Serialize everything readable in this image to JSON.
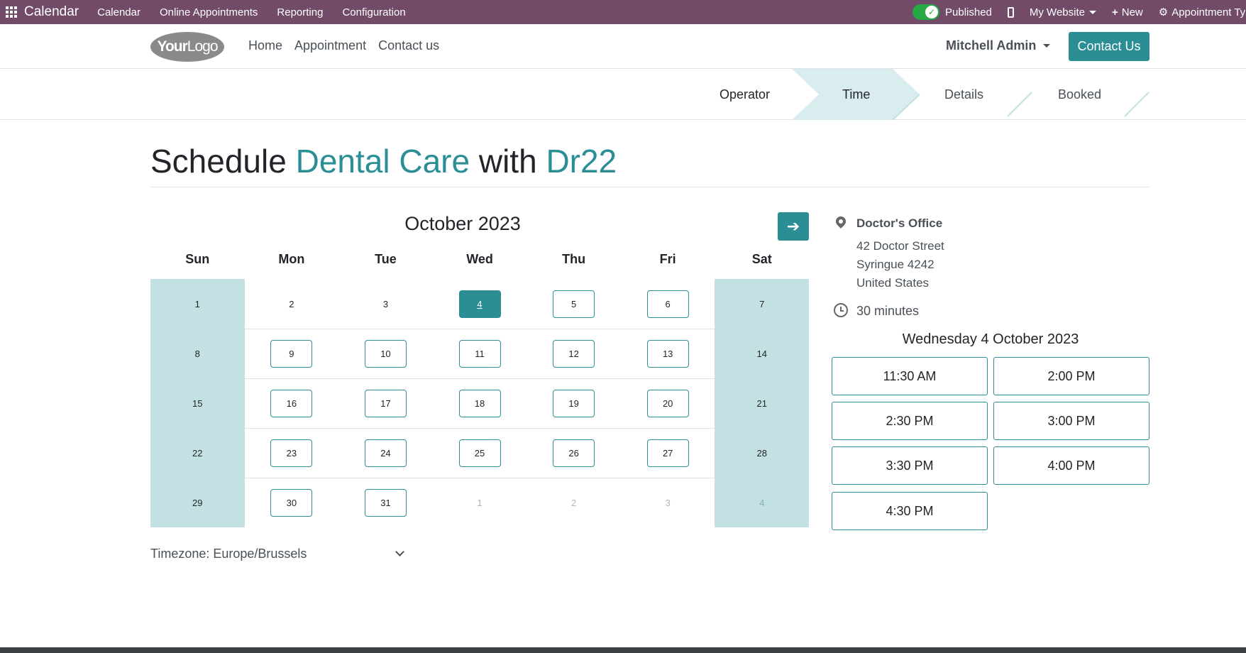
{
  "topbar": {
    "app_name": "Calendar",
    "menus": [
      "Calendar",
      "Online Appointments",
      "Reporting",
      "Configuration"
    ],
    "published": "Published",
    "my_website": "My Website",
    "new": "New",
    "appointment_type": "Appointment Typ",
    "bar_color": "#714b67"
  },
  "header": {
    "logo_text_bold": "Your",
    "logo_text_thin": "Logo",
    "nav": [
      "Home",
      "Appointment",
      "Contact us"
    ],
    "user": "Mitchell Admin",
    "contact_button": "Contact Us"
  },
  "steps": [
    "Operator",
    "Time",
    "Details",
    "Booked"
  ],
  "active_step": "Time",
  "title": {
    "prefix": "Schedule ",
    "service": "Dental Care",
    "middle": " with ",
    "staff": "Dr22"
  },
  "calendar": {
    "month": "October 2023",
    "weekdays": [
      "Sun",
      "Mon",
      "Tue",
      "Wed",
      "Thu",
      "Fri",
      "Sat"
    ],
    "weeks": [
      [
        "1",
        "2",
        "3",
        "4",
        "5",
        "6",
        "7"
      ],
      [
        "8",
        "9",
        "10",
        "11",
        "12",
        "13",
        "14"
      ],
      [
        "15",
        "16",
        "17",
        "18",
        "19",
        "20",
        "21"
      ],
      [
        "22",
        "23",
        "24",
        "25",
        "26",
        "27",
        "28"
      ],
      [
        "29",
        "30",
        "31",
        "1",
        "2",
        "3",
        "4"
      ]
    ],
    "available_days": [
      "4",
      "5",
      "6",
      "9",
      "10",
      "11",
      "12",
      "13",
      "16",
      "17",
      "18",
      "19",
      "20",
      "23",
      "24",
      "25",
      "26",
      "27",
      "30",
      "31"
    ],
    "selected_day": "4",
    "accent": "#2a8e94"
  },
  "timezone": "Timezone: Europe/Brussels",
  "info": {
    "location_name": "Doctor's Office",
    "address": [
      "42 Doctor Street",
      "Syringue 4242",
      "United States"
    ],
    "duration": "30 minutes",
    "slot_date": "Wednesday 4 October 2023",
    "slots": [
      "11:30 AM",
      "2:00 PM",
      "2:30 PM",
      "3:00 PM",
      "3:30 PM",
      "4:00 PM",
      "4:30 PM"
    ]
  }
}
